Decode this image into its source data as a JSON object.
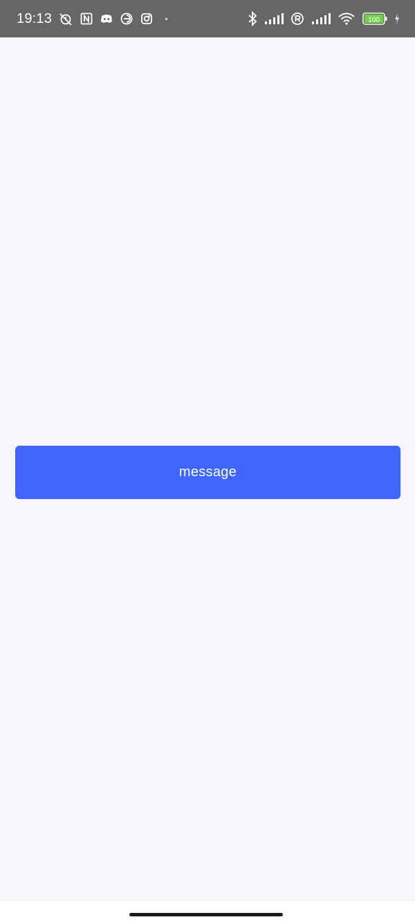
{
  "status_bar": {
    "time": "19:13",
    "battery_level": "100",
    "left_icons": [
      "alarm-off-icon",
      "nfc-icon",
      "discord-icon",
      "browser-icon",
      "instagram-icon"
    ],
    "right_icons": [
      "bluetooth-icon",
      "signal-icon",
      "sim-r-icon",
      "signal-icon",
      "wifi-icon",
      "battery-icon",
      "charging-icon"
    ],
    "colors": {
      "background": "#666666",
      "battery": "#6fd34a"
    }
  },
  "main": {
    "button_label": "message",
    "button_color": "#3f65fa",
    "background_color": "#f8f6fa"
  }
}
